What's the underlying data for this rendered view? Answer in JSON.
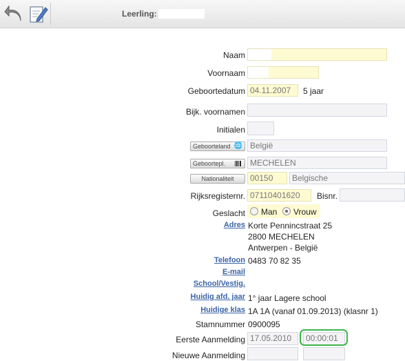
{
  "toolbar": {
    "back_icon": "undo-arrow-icon",
    "edit_icon": "edit-pencil-icon"
  },
  "student": {
    "label": "Leerling:"
  },
  "form": {
    "naam": {
      "label": "Naam"
    },
    "voornaam": {
      "label": "Voornaam"
    },
    "geboortedatum": {
      "label": "Geboortedatum",
      "value": "04.11.2007",
      "age": "5 jaar"
    },
    "bijk_voornamen": {
      "label": "Bijk. voornamen"
    },
    "initialen": {
      "label": "Initialen"
    },
    "geboorteland": {
      "button": "Geboorteland",
      "value": "België"
    },
    "geboorteplaats": {
      "button": "Geboortepl.",
      "value": "MECHELEN"
    },
    "nationaliteit": {
      "button": "Nationaliteit",
      "code": "00150",
      "value": "Belgische"
    },
    "rijksregister": {
      "label": "Rijksregisternr.",
      "value": "07110401620",
      "bisnr_label": "Bisnr."
    },
    "geslacht": {
      "label": "Geslacht",
      "option_man": "Man",
      "option_vrouw": "Vrouw",
      "selected": "Vrouw"
    },
    "adres": {
      "label": "Adres",
      "line1": "Korte Pennincstraat 25",
      "line2": "2800  MECHELEN",
      "line3": "Antwerpen - België"
    },
    "telefoon": {
      "label": "Telefoon",
      "value": "0483 70 82 35"
    },
    "email": {
      "label": "E-mail"
    },
    "school": {
      "label": "School/Vestig."
    },
    "afdeling": {
      "label": "Huidig afd. jaar",
      "value": "1° jaar Lagere school"
    },
    "klas": {
      "label": "Huidige klas",
      "value": "1A  1A (vanaf 01.09.2013) (klasnr 1)"
    },
    "stamnummer": {
      "label": "Stamnummer",
      "value": "0900095"
    },
    "eerste_aanmelding": {
      "label": "Eerste Aanmelding",
      "date": "17.05.2010",
      "time": "00:00:01"
    },
    "nieuwe_aanmelding": {
      "label": "Nieuwe Aanmelding"
    }
  },
  "colors": {
    "highlight": "#3bb54a",
    "link": "#3a64a8",
    "field_yellow": "#fefbd2"
  }
}
